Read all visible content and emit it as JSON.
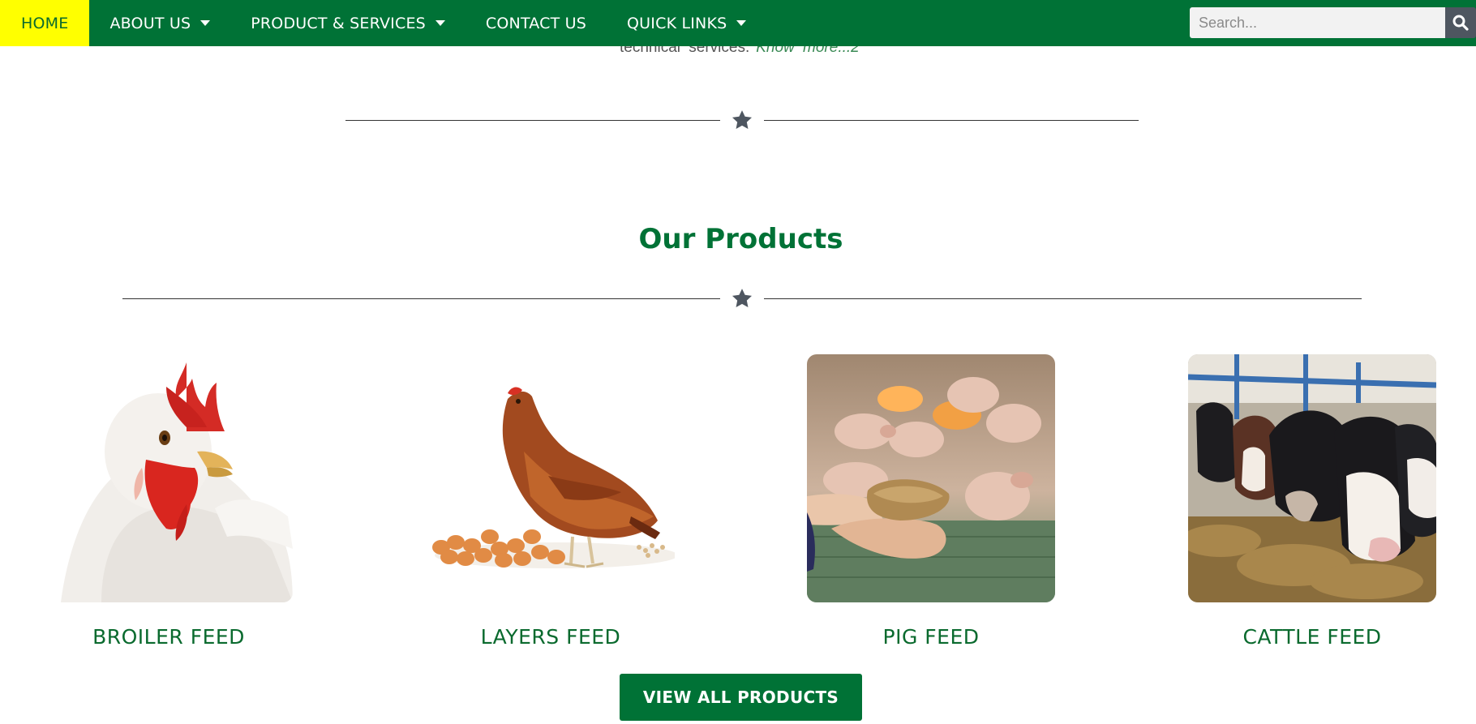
{
  "nav": {
    "items": [
      {
        "label": "HOME",
        "active": true,
        "dropdown": false
      },
      {
        "label": "ABOUT US",
        "active": false,
        "dropdown": true
      },
      {
        "label": "PRODUCT & SERVICES",
        "active": false,
        "dropdown": true
      },
      {
        "label": "CONTACT US",
        "active": false,
        "dropdown": false
      },
      {
        "label": "QUICK LINKS",
        "active": false,
        "dropdown": true
      }
    ],
    "search": {
      "placeholder": "Search...",
      "value": "",
      "icon": "search-icon"
    }
  },
  "intro": {
    "text": "technical  services.",
    "more_link": "Know  more...2"
  },
  "products_section": {
    "title": "Our Products",
    "divider_icon": "star-icon",
    "items": [
      {
        "name": "BROILER FEED",
        "image": "white-broiler-chicken"
      },
      {
        "name": "LAYERS FEED",
        "image": "brown-hen-with-eggs"
      },
      {
        "name": "PIG FEED",
        "image": "hands-holding-feed-piglets"
      },
      {
        "name": "CATTLE FEED",
        "image": "dairy-cows-eating-hay"
      }
    ],
    "cta_label": "VIEW ALL PRODUCTS"
  },
  "colors": {
    "brand_green": "#007236",
    "active_nav_bg": "#ffff00",
    "star_gray": "#4e5660",
    "search_button": "#4e5660"
  }
}
